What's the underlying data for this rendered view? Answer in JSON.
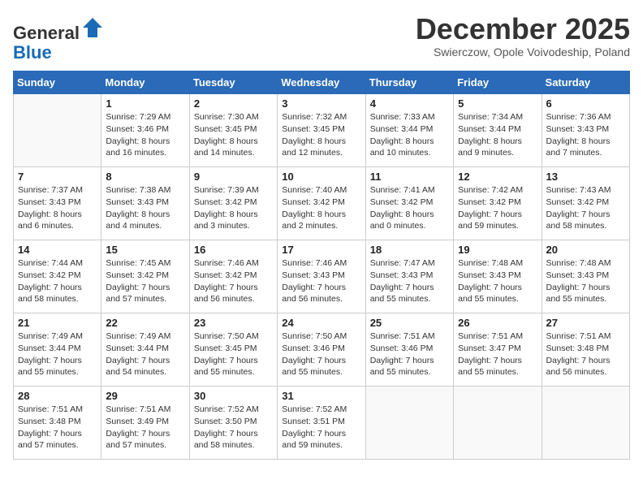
{
  "header": {
    "logo_general": "General",
    "logo_blue": "Blue",
    "month_title": "December 2025",
    "subtitle": "Swierczow, Opole Voivodeship, Poland"
  },
  "weekdays": [
    "Sunday",
    "Monday",
    "Tuesday",
    "Wednesday",
    "Thursday",
    "Friday",
    "Saturday"
  ],
  "weeks": [
    [
      {
        "day": "",
        "info": ""
      },
      {
        "day": "1",
        "info": "Sunrise: 7:29 AM\nSunset: 3:46 PM\nDaylight: 8 hours\nand 16 minutes."
      },
      {
        "day": "2",
        "info": "Sunrise: 7:30 AM\nSunset: 3:45 PM\nDaylight: 8 hours\nand 14 minutes."
      },
      {
        "day": "3",
        "info": "Sunrise: 7:32 AM\nSunset: 3:45 PM\nDaylight: 8 hours\nand 12 minutes."
      },
      {
        "day": "4",
        "info": "Sunrise: 7:33 AM\nSunset: 3:44 PM\nDaylight: 8 hours\nand 10 minutes."
      },
      {
        "day": "5",
        "info": "Sunrise: 7:34 AM\nSunset: 3:44 PM\nDaylight: 8 hours\nand 9 minutes."
      },
      {
        "day": "6",
        "info": "Sunrise: 7:36 AM\nSunset: 3:43 PM\nDaylight: 8 hours\nand 7 minutes."
      }
    ],
    [
      {
        "day": "7",
        "info": "Sunrise: 7:37 AM\nSunset: 3:43 PM\nDaylight: 8 hours\nand 6 minutes."
      },
      {
        "day": "8",
        "info": "Sunrise: 7:38 AM\nSunset: 3:43 PM\nDaylight: 8 hours\nand 4 minutes."
      },
      {
        "day": "9",
        "info": "Sunrise: 7:39 AM\nSunset: 3:42 PM\nDaylight: 8 hours\nand 3 minutes."
      },
      {
        "day": "10",
        "info": "Sunrise: 7:40 AM\nSunset: 3:42 PM\nDaylight: 8 hours\nand 2 minutes."
      },
      {
        "day": "11",
        "info": "Sunrise: 7:41 AM\nSunset: 3:42 PM\nDaylight: 8 hours\nand 0 minutes."
      },
      {
        "day": "12",
        "info": "Sunrise: 7:42 AM\nSunset: 3:42 PM\nDaylight: 7 hours\nand 59 minutes."
      },
      {
        "day": "13",
        "info": "Sunrise: 7:43 AM\nSunset: 3:42 PM\nDaylight: 7 hours\nand 58 minutes."
      }
    ],
    [
      {
        "day": "14",
        "info": "Sunrise: 7:44 AM\nSunset: 3:42 PM\nDaylight: 7 hours\nand 58 minutes."
      },
      {
        "day": "15",
        "info": "Sunrise: 7:45 AM\nSunset: 3:42 PM\nDaylight: 7 hours\nand 57 minutes."
      },
      {
        "day": "16",
        "info": "Sunrise: 7:46 AM\nSunset: 3:42 PM\nDaylight: 7 hours\nand 56 minutes."
      },
      {
        "day": "17",
        "info": "Sunrise: 7:46 AM\nSunset: 3:43 PM\nDaylight: 7 hours\nand 56 minutes."
      },
      {
        "day": "18",
        "info": "Sunrise: 7:47 AM\nSunset: 3:43 PM\nDaylight: 7 hours\nand 55 minutes."
      },
      {
        "day": "19",
        "info": "Sunrise: 7:48 AM\nSunset: 3:43 PM\nDaylight: 7 hours\nand 55 minutes."
      },
      {
        "day": "20",
        "info": "Sunrise: 7:48 AM\nSunset: 3:43 PM\nDaylight: 7 hours\nand 55 minutes."
      }
    ],
    [
      {
        "day": "21",
        "info": "Sunrise: 7:49 AM\nSunset: 3:44 PM\nDaylight: 7 hours\nand 55 minutes."
      },
      {
        "day": "22",
        "info": "Sunrise: 7:49 AM\nSunset: 3:44 PM\nDaylight: 7 hours\nand 54 minutes."
      },
      {
        "day": "23",
        "info": "Sunrise: 7:50 AM\nSunset: 3:45 PM\nDaylight: 7 hours\nand 55 minutes."
      },
      {
        "day": "24",
        "info": "Sunrise: 7:50 AM\nSunset: 3:46 PM\nDaylight: 7 hours\nand 55 minutes."
      },
      {
        "day": "25",
        "info": "Sunrise: 7:51 AM\nSunset: 3:46 PM\nDaylight: 7 hours\nand 55 minutes."
      },
      {
        "day": "26",
        "info": "Sunrise: 7:51 AM\nSunset: 3:47 PM\nDaylight: 7 hours\nand 55 minutes."
      },
      {
        "day": "27",
        "info": "Sunrise: 7:51 AM\nSunset: 3:48 PM\nDaylight: 7 hours\nand 56 minutes."
      }
    ],
    [
      {
        "day": "28",
        "info": "Sunrise: 7:51 AM\nSunset: 3:48 PM\nDaylight: 7 hours\nand 57 minutes."
      },
      {
        "day": "29",
        "info": "Sunrise: 7:51 AM\nSunset: 3:49 PM\nDaylight: 7 hours\nand 57 minutes."
      },
      {
        "day": "30",
        "info": "Sunrise: 7:52 AM\nSunset: 3:50 PM\nDaylight: 7 hours\nand 58 minutes."
      },
      {
        "day": "31",
        "info": "Sunrise: 7:52 AM\nSunset: 3:51 PM\nDaylight: 7 hours\nand 59 minutes."
      },
      {
        "day": "",
        "info": ""
      },
      {
        "day": "",
        "info": ""
      },
      {
        "day": "",
        "info": ""
      }
    ]
  ]
}
